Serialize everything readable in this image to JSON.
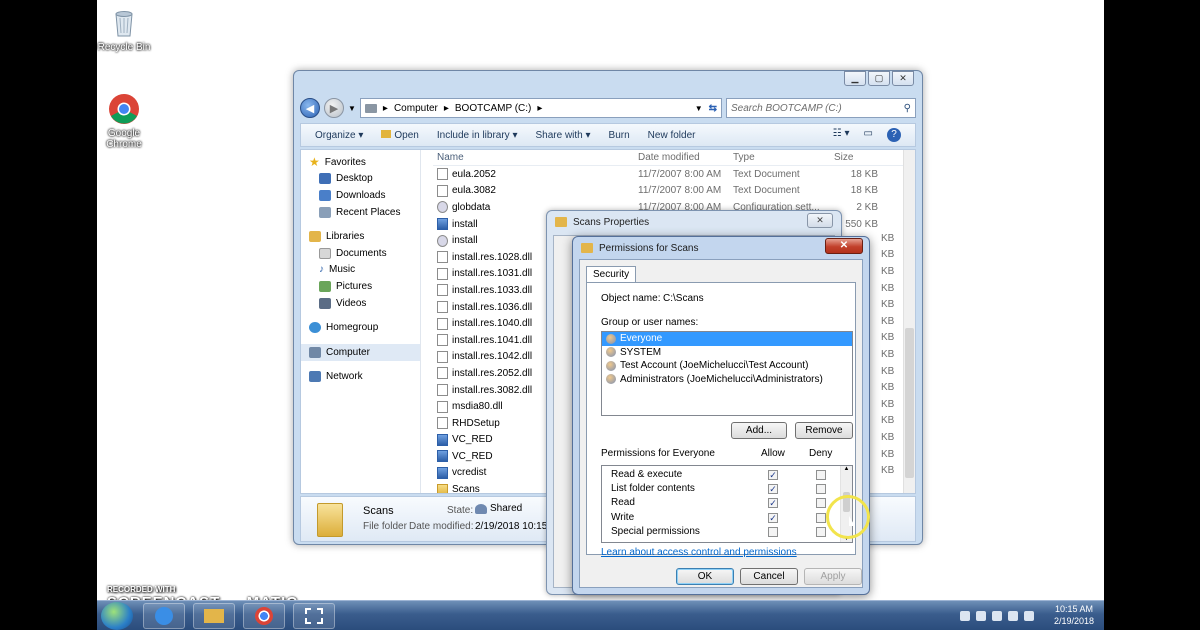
{
  "desktop": {
    "icons": [
      {
        "label": "Recycle Bin",
        "icon": "recycle-bin-icon"
      },
      {
        "label": "Google Chrome",
        "icon": "chrome-icon"
      }
    ]
  },
  "explorer": {
    "breadcrumb": [
      "Computer",
      "BOOTCAMP (C:)"
    ],
    "search_placeholder": "Search BOOTCAMP (C:)",
    "toolbar": {
      "organize": "Organize",
      "open": "Open",
      "include": "Include in library",
      "share": "Share with",
      "burn": "Burn",
      "new_folder": "New folder"
    },
    "nav": {
      "favorites": "Favorites",
      "desktop": "Desktop",
      "downloads": "Downloads",
      "recent": "Recent Places",
      "libraries": "Libraries",
      "documents": "Documents",
      "music": "Music",
      "pictures": "Pictures",
      "videos": "Videos",
      "homegroup": "Homegroup",
      "computer": "Computer",
      "network": "Network"
    },
    "columns": {
      "name": "Name",
      "date": "Date modified",
      "type": "Type",
      "size": "Size"
    },
    "files": [
      {
        "name": "eula.2052",
        "date": "11/7/2007 8:00 AM",
        "type": "Text Document",
        "size": "18 KB",
        "icon": "txt"
      },
      {
        "name": "eula.3082",
        "date": "11/7/2007 8:00 AM",
        "type": "Text Document",
        "size": "18 KB",
        "icon": "txt"
      },
      {
        "name": "globdata",
        "date": "11/7/2007 8:00 AM",
        "type": "Configuration sett...",
        "size": "2 KB",
        "icon": "cfg"
      },
      {
        "name": "install",
        "date": "",
        "type": "",
        "size": "550 KB",
        "icon": "exe"
      },
      {
        "name": "install",
        "date": "",
        "type": "",
        "size": "",
        "icon": "cfg"
      },
      {
        "name": "install.res.1028.dll",
        "date": "",
        "type": "",
        "size": "",
        "icon": "txt"
      },
      {
        "name": "install.res.1031.dll",
        "date": "",
        "type": "",
        "size": "",
        "icon": "txt"
      },
      {
        "name": "install.res.1033.dll",
        "date": "",
        "type": "",
        "size": "",
        "icon": "txt"
      },
      {
        "name": "install.res.1036.dll",
        "date": "",
        "type": "",
        "size": "",
        "icon": "txt"
      },
      {
        "name": "install.res.1040.dll",
        "date": "",
        "type": "",
        "size": "",
        "icon": "txt"
      },
      {
        "name": "install.res.1041.dll",
        "date": "",
        "type": "",
        "size": "",
        "icon": "txt"
      },
      {
        "name": "install.res.1042.dll",
        "date": "",
        "type": "",
        "size": "",
        "icon": "txt"
      },
      {
        "name": "install.res.2052.dll",
        "date": "",
        "type": "",
        "size": "",
        "icon": "txt"
      },
      {
        "name": "install.res.3082.dll",
        "date": "",
        "type": "",
        "size": "",
        "icon": "txt"
      },
      {
        "name": "msdia80.dll",
        "date": "",
        "type": "",
        "size": "",
        "icon": "txt"
      },
      {
        "name": "RHDSetup",
        "date": "",
        "type": "",
        "size": "",
        "icon": "txt"
      },
      {
        "name": "VC_RED",
        "date": "",
        "type": "",
        "size": "",
        "icon": "exe"
      },
      {
        "name": "VC_RED",
        "date": "",
        "type": "",
        "size": "",
        "icon": "exe"
      },
      {
        "name": "vcredist",
        "date": "",
        "type": "",
        "size": "",
        "icon": "exe"
      },
      {
        "name": "Scans",
        "date": "",
        "type": "",
        "size": "",
        "icon": "folder"
      }
    ],
    "right_sizes": [
      "KB",
      "KB",
      "KB",
      "KB",
      "KB",
      "KB",
      "KB",
      "KB",
      "KB",
      "KB",
      "KB",
      "KB",
      "KB",
      "KB",
      "KB"
    ],
    "details": {
      "name": "Scans",
      "kind": "File folder",
      "state_label": "State:",
      "state_value": "Shared",
      "date_label": "Date modified:",
      "date_value": "2/19/2018 10:15 AM"
    }
  },
  "properties": {
    "title": "Scans Properties"
  },
  "permissions": {
    "title": "Permissions for Scans",
    "tab": "Security",
    "object_label": "Object name:",
    "object_value": "C:\\Scans",
    "group_label": "Group or user names:",
    "users": [
      "Everyone",
      "SYSTEM",
      "Test Account (JoeMichelucci\\Test Account)",
      "Administrators (JoeMichelucci\\Administrators)"
    ],
    "add_button": "Add...",
    "remove_button": "Remove",
    "perms_label": "Permissions for Everyone",
    "allow_label": "Allow",
    "deny_label": "Deny",
    "perms": [
      {
        "name": "Read & execute",
        "allow": true,
        "deny": false
      },
      {
        "name": "List folder contents",
        "allow": true,
        "deny": false
      },
      {
        "name": "Read",
        "allow": true,
        "deny": false
      },
      {
        "name": "Write",
        "allow": true,
        "deny": false
      },
      {
        "name": "Special permissions",
        "allow": false,
        "deny": false
      }
    ],
    "link": "Learn about access control and permissions",
    "ok": "OK",
    "cancel": "Cancel",
    "apply": "Apply"
  },
  "watermark": {
    "line1": "RECORDED WITH",
    "line2": "SCREENCAST",
    "line3": "MATIC"
  },
  "clock": {
    "time": "10:15 AM",
    "date": "2/19/2018"
  }
}
